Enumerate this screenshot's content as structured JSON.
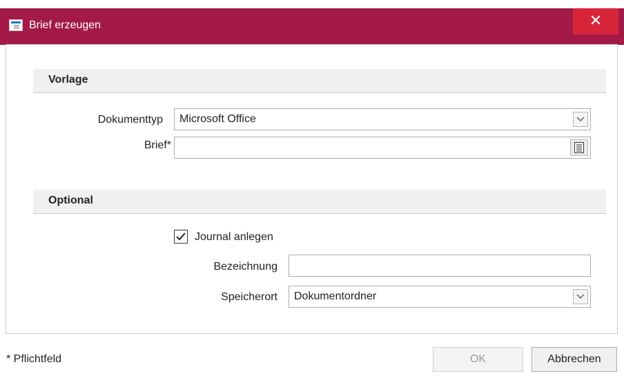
{
  "window": {
    "title": "Brief erzeugen",
    "close_label": "✕",
    "accent_color": "#a31a47"
  },
  "vorlage": {
    "header": "Vorlage",
    "dokumenttyp_label": "Dokumenttyp",
    "dokumenttyp_value": "Microsoft Office",
    "brief_label": "Brief*",
    "brief_value": ""
  },
  "optional": {
    "header": "Optional",
    "journal_label": "Journal anlegen",
    "journal_checked": true,
    "bezeichnung_label": "Bezeichnung",
    "bezeichnung_value": "",
    "speicherort_label": "Speicherort",
    "speicherort_value": "Dokumentordner"
  },
  "footer": {
    "note": "* Pflichtfeld",
    "ok_label": "OK",
    "cancel_label": "Abbrechen"
  }
}
